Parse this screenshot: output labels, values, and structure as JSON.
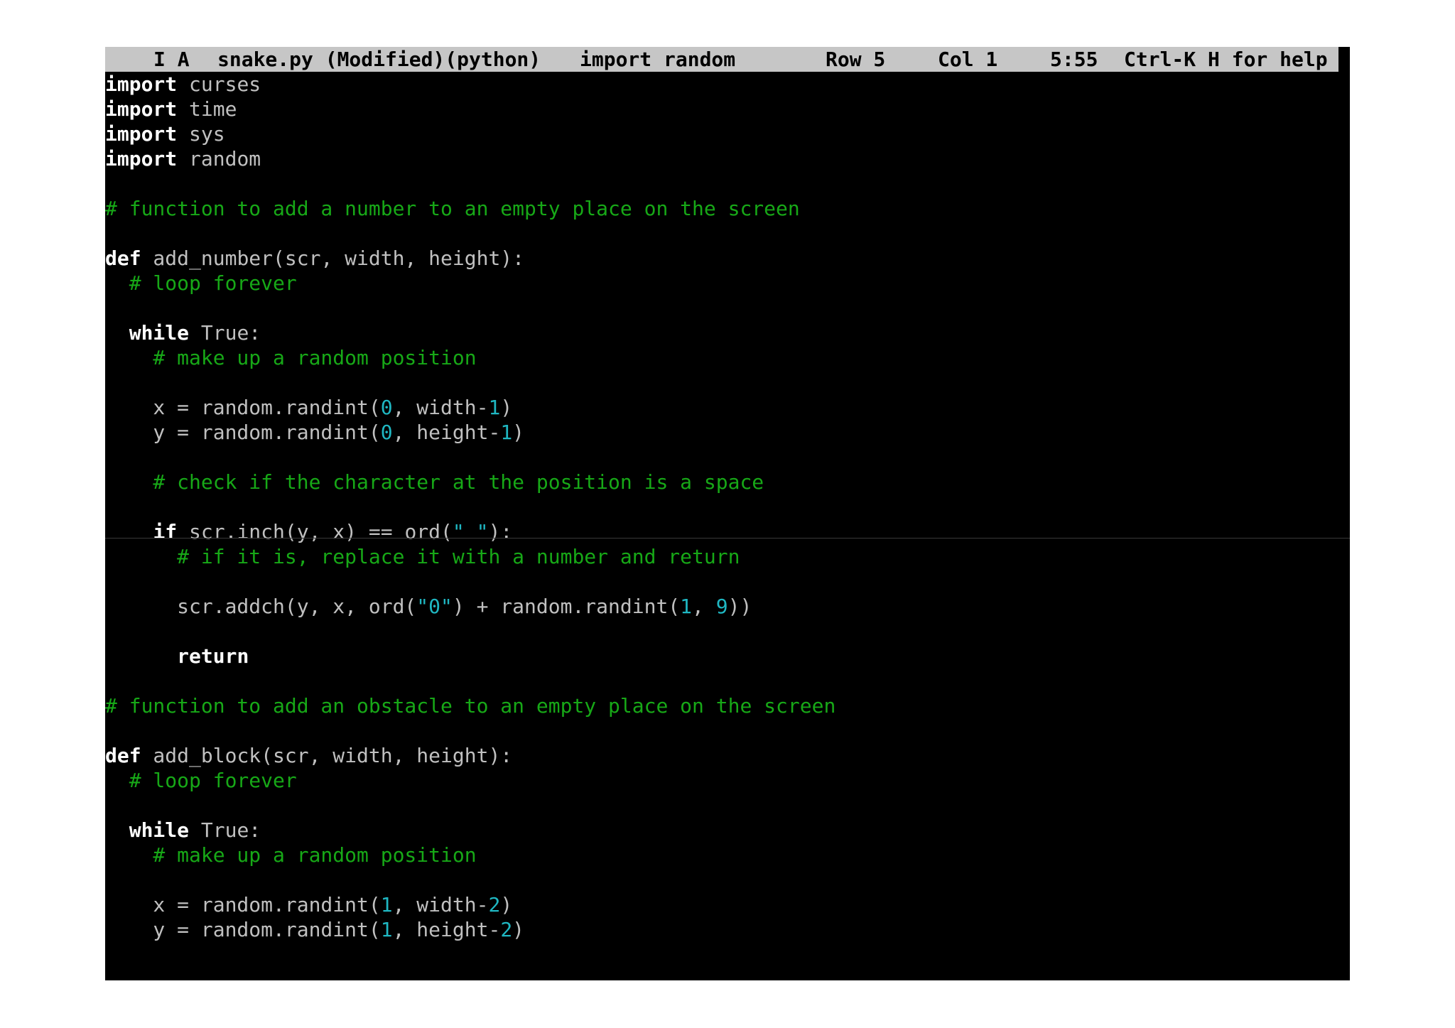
{
  "status_bar": {
    "mode": "I A",
    "file": "snake.py (Modified)(python)",
    "current_line": "import random",
    "row": "Row 5",
    "col": "Col 1",
    "time": "5:55",
    "help": "Ctrl-K H for help"
  },
  "code": {
    "l1_kw": "import",
    "l1_rest": " curses",
    "l2_kw": "import",
    "l2_rest": " time",
    "l3_kw": "import",
    "l3_rest": " sys",
    "l4_kw": "import",
    "l4_rest": " random",
    "l6_cm": "# function to add a number to an empty place on the screen",
    "l8_kw": "def",
    "l8_rest": " add_number(scr, width, height):",
    "l9_cm": "  # loop forever",
    "l11_indent": "  ",
    "l11_kw": "while",
    "l11_rest": " True:",
    "l12_cm": "    # make up a random position",
    "l14_a": "    x = random.randint(",
    "l14_n1": "0",
    "l14_b": ", width-",
    "l14_n2": "1",
    "l14_c": ")",
    "l15_a": "    y = random.randint(",
    "l15_n1": "0",
    "l15_b": ", height-",
    "l15_n2": "1",
    "l15_c": ")",
    "l17_cm": "    # check if the character at the position is a space",
    "l19_indent": "    ",
    "l19_kw": "if",
    "l19_a": " scr.inch(y, x) == ord(",
    "l19_s": "\" \"",
    "l19_b": "):",
    "l20_cm": "      # if it is, replace it with a number and return",
    "l22_a": "      scr.addch(y, x, ord(",
    "l22_s": "\"0\"",
    "l22_b": ") + random.randint(",
    "l22_n1": "1",
    "l22_c": ", ",
    "l22_n2": "9",
    "l22_d": "))",
    "l24_indent": "      ",
    "l24_kw": "return",
    "l26_cm": "# function to add an obstacle to an empty place on the screen",
    "l28_kw": "def",
    "l28_rest": " add_block(scr, width, height):",
    "l29_cm": "  # loop forever",
    "l31_indent": "  ",
    "l31_kw": "while",
    "l31_rest": " True:",
    "l32_cm": "    # make up a random position",
    "l34_a": "    x = random.randint(",
    "l34_n1": "1",
    "l34_b": ", width-",
    "l34_n2": "2",
    "l34_c": ")",
    "l35_a": "    y = random.randint(",
    "l35_n1": "1",
    "l35_b": ", height-",
    "l35_n2": "2",
    "l35_c": ")"
  },
  "colors": {
    "background": "#000000",
    "status_bar": "#c6c6c6",
    "keyword": "#ffffff",
    "comment": "#17a817",
    "number": "#1fb7c2",
    "text": "#c0c0c0"
  }
}
